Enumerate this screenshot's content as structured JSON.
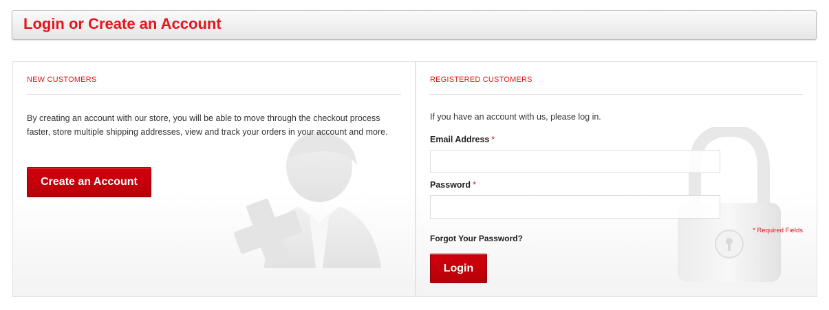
{
  "page": {
    "title": "Login or Create an Account"
  },
  "new_customers": {
    "heading": "NEW CUSTOMERS",
    "description": "By creating an account with our store, you will be able to move through the checkout process faster, store multiple shipping addresses, view and track your orders in your account and more.",
    "create_button_label": "Create an Account",
    "decoration_icon": "user-add-icon"
  },
  "registered_customers": {
    "heading": "REGISTERED CUSTOMERS",
    "intro": "If you have an account with us, please log in.",
    "email_label": "Email Address",
    "email_value": "",
    "password_label": "Password",
    "password_value": "",
    "required_star": "*",
    "required_note": "* Required Fields",
    "forgot_link": "Forgot Your Password?",
    "login_button_label": "Login",
    "decoration_icon": "padlock-icon"
  },
  "colors": {
    "accent": "#e8141b",
    "button": "#c4000b"
  }
}
